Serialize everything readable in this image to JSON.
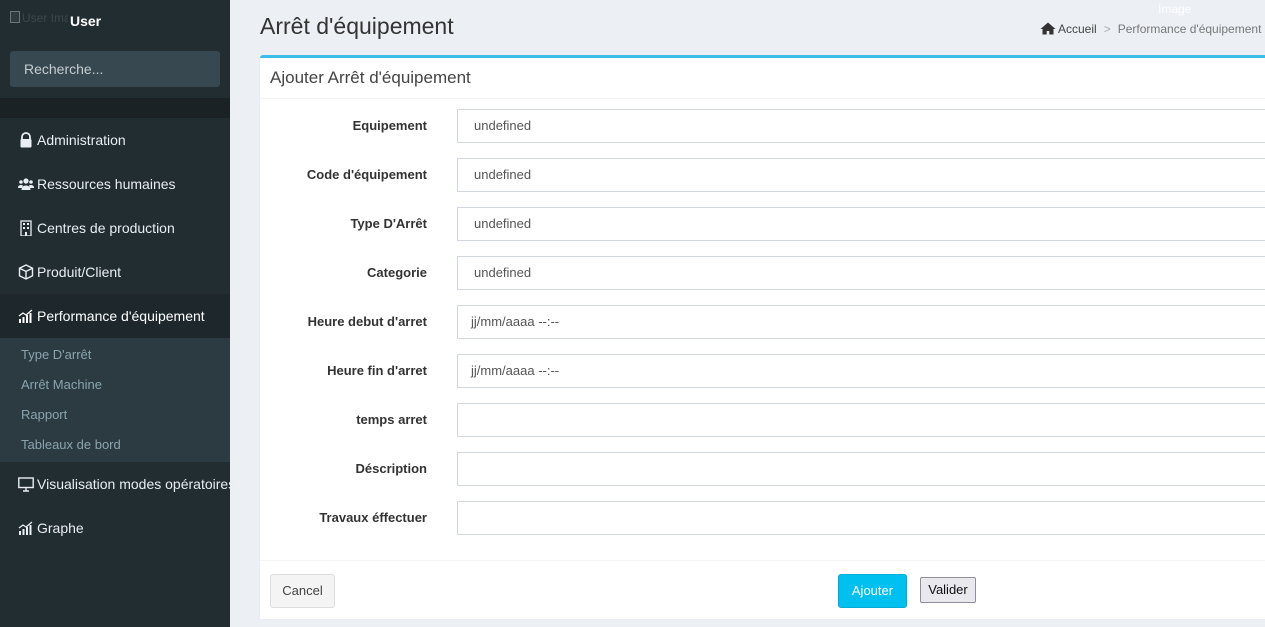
{
  "sidebar": {
    "user_name": "User",
    "broken_avatar_alt": "User Image",
    "search_placeholder": "Recherche...",
    "menu": [
      {
        "label": "Administration",
        "icon": "lock-icon"
      },
      {
        "label": "Ressources humaines",
        "icon": "users-icon"
      },
      {
        "label": "Centres de production",
        "icon": "building-icon"
      },
      {
        "label": "Produit/Client",
        "icon": "cube-icon"
      },
      {
        "label": "Performance d'équipement",
        "icon": "bar-chart-icon",
        "active": true,
        "submenu": [
          "Type D'arrêt",
          "Arrêt Machine",
          "Rapport",
          "Tableaux de bord"
        ]
      },
      {
        "label": "Visualisation modes opératoires",
        "icon": "monitor-icon"
      },
      {
        "label": "Graphe",
        "icon": "bar-chart-icon"
      }
    ]
  },
  "header": {
    "title": "Arrêt d'équipement",
    "breadcrumb": {
      "home": "Accueil",
      "separator": ">",
      "current": "Performance d'équipement",
      "trailing": ">"
    },
    "broken_image_text": "Image"
  },
  "form": {
    "title": "Ajouter Arrêt d'équipement",
    "fields": [
      {
        "label": "Equipement",
        "value": "undefined"
      },
      {
        "label": "Code d'équipement",
        "value": "undefined"
      },
      {
        "label": "Type D'Arrêt",
        "value": "undefined"
      },
      {
        "label": "Categorie",
        "value": "undefined"
      },
      {
        "label": "Heure debut d'arret",
        "value": "jj/mm/aaaa --:--"
      },
      {
        "label": "Heure fin d'arret",
        "value": "jj/mm/aaaa --:--"
      },
      {
        "label": "temps arret",
        "value": ""
      },
      {
        "label": "Déscription",
        "value": ""
      },
      {
        "label": "Travaux éffectuer",
        "value": ""
      }
    ],
    "buttons": {
      "cancel": "Cancel",
      "add": "Ajouter",
      "validate": "Valider"
    }
  },
  "colors": {
    "sidebar_bg": "#222d32",
    "accent": "#3bbde8",
    "button_info": "#00c0ef",
    "page_bg": "#ecf0f5"
  }
}
